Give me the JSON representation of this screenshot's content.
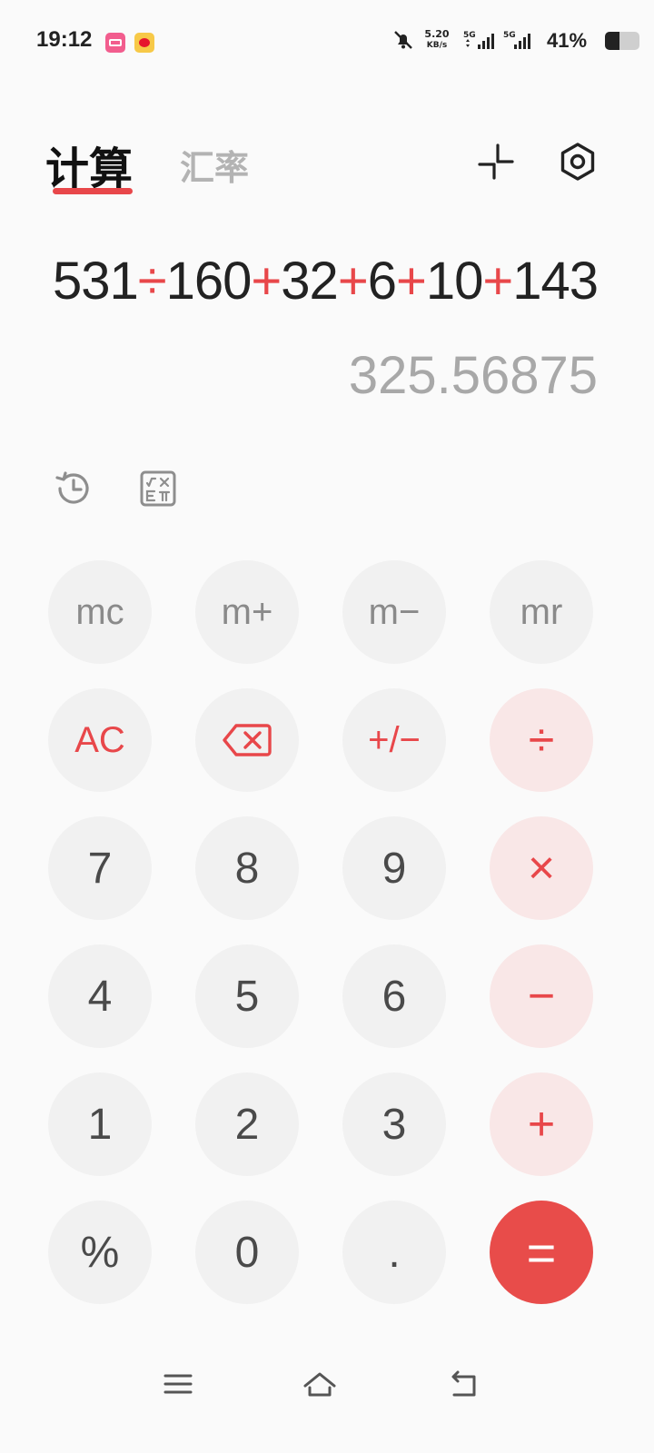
{
  "status_bar": {
    "time": "19:12",
    "speed_value": "5.20",
    "speed_unit": "KB/s",
    "network1": "5G",
    "network2": "5G",
    "battery_percent": "41%",
    "battery_level": 0.41
  },
  "tabs": {
    "calculate": "计算",
    "exchange_rate": "汇率"
  },
  "display": {
    "expression": [
      {
        "text": "531",
        "op": false
      },
      {
        "text": "÷",
        "op": true
      },
      {
        "text": "160",
        "op": false
      },
      {
        "text": "+",
        "op": true
      },
      {
        "text": "32",
        "op": false
      },
      {
        "text": "+",
        "op": true
      },
      {
        "text": "6",
        "op": false
      },
      {
        "text": "+",
        "op": true
      },
      {
        "text": "10",
        "op": false
      },
      {
        "text": "+",
        "op": true
      },
      {
        "text": "143",
        "op": false
      }
    ],
    "result": "325.56875"
  },
  "keys": {
    "mc": "mc",
    "m_plus": "m+",
    "m_minus": "m−",
    "mr": "mr",
    "ac": "AC",
    "sign": "+/−",
    "divide": "÷",
    "multiply": "×",
    "minus": "−",
    "plus": "+",
    "equals": "=",
    "seven": "7",
    "eight": "8",
    "nine": "9",
    "four": "4",
    "five": "5",
    "six": "6",
    "one": "1",
    "two": "2",
    "three": "3",
    "percent": "%",
    "zero": "0",
    "dot": "."
  },
  "colors": {
    "accent": "#e8474a",
    "key_bg": "#f1f1f1",
    "operator_bg": "#f9e7e7"
  }
}
